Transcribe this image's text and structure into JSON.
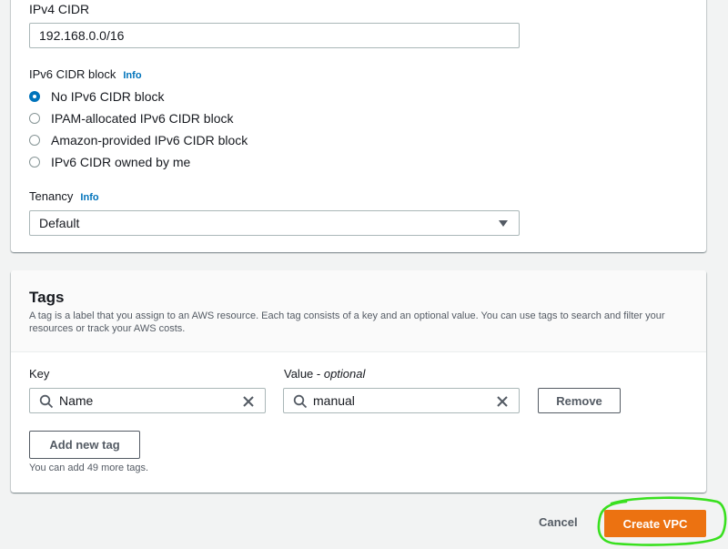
{
  "ipv4": {
    "label": "IPv4 CIDR",
    "value": "192.168.0.0/16"
  },
  "ipv6": {
    "label": "IPv6 CIDR block",
    "info": "Info",
    "options": [
      {
        "label": "No IPv6 CIDR block",
        "checked": true
      },
      {
        "label": "IPAM-allocated IPv6 CIDR block",
        "checked": false
      },
      {
        "label": "Amazon-provided IPv6 CIDR block",
        "checked": false
      },
      {
        "label": "IPv6 CIDR owned by me",
        "checked": false
      }
    ]
  },
  "tenancy": {
    "label": "Tenancy",
    "info": "Info",
    "value": "Default"
  },
  "tags": {
    "title": "Tags",
    "description": "A tag is a label that you assign to an AWS resource. Each tag consists of a key and an optional value. You can use tags to search and filter your resources or track your AWS costs.",
    "key_label": "Key",
    "value_label": "Value - ",
    "value_optional": "optional",
    "key_value": "Name",
    "value_value": "manual",
    "remove_label": "Remove",
    "add_label": "Add new tag",
    "hint": "You can add 49 more tags."
  },
  "footer": {
    "cancel_label": "Cancel",
    "create_label": "Create VPC"
  },
  "colors": {
    "primary": "#ec7211",
    "link": "#0073bb",
    "highlight": "#39e01f"
  },
  "icons": [
    "search-icon",
    "close-icon",
    "caret-down-icon"
  ]
}
